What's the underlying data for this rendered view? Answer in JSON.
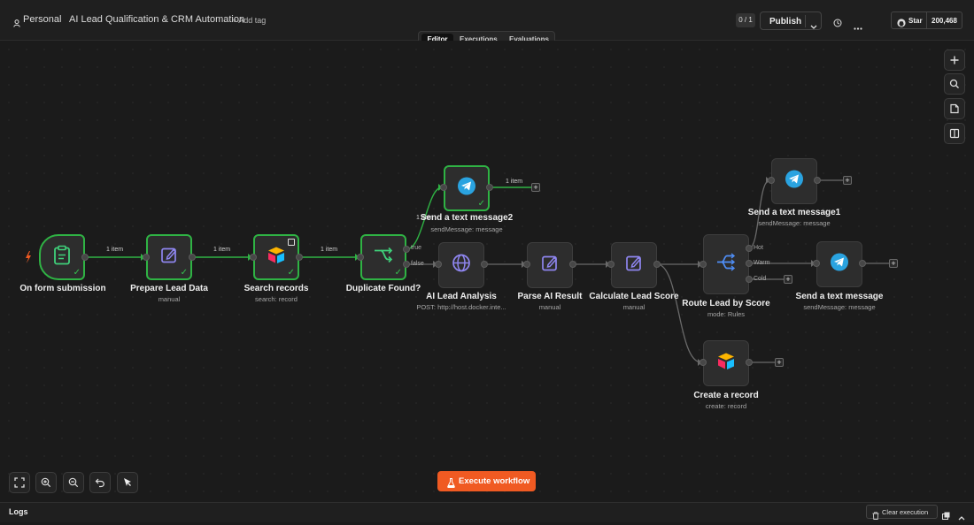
{
  "header": {
    "project": "Personal",
    "workflow_name": "AI Lead Qualification & CRM Automation",
    "add_tag": "+ Add tag",
    "tabs": [
      "Editor",
      "Executions",
      "Evaluations"
    ],
    "active_tab": "Editor",
    "version_counter": "0 / 1",
    "publish_label": "Publish",
    "github_star_label": "Star",
    "github_star_count": "200,468"
  },
  "nodes": {
    "form": {
      "label": "On form submission"
    },
    "prepare": {
      "label": "Prepare Lead Data",
      "sub": "manual"
    },
    "search": {
      "label": "Search records",
      "sub": "search: record"
    },
    "duplicate": {
      "label": "Duplicate Found?"
    },
    "send2": {
      "label": "Send a text message2",
      "sub": "sendMessage: message"
    },
    "ai": {
      "label": "AI Lead Analysis",
      "sub": "POST: http://host.docker.inte..."
    },
    "parse": {
      "label": "Parse AI Result",
      "sub": "manual"
    },
    "calc": {
      "label": "Calculate Lead Score",
      "sub": "manual"
    },
    "route": {
      "label": "Route Lead by Score",
      "sub": "mode: Rules"
    },
    "send1": {
      "label": "Send a text message1",
      "sub": "sendMessage: message"
    },
    "send": {
      "label": "Send a text message",
      "sub": "sendMessage: message"
    },
    "create": {
      "label": "Create a record",
      "sub": "create: record"
    }
  },
  "edges": {
    "item_label": "1 item",
    "true_label": "true",
    "false_label": "false",
    "hot": "Hot",
    "warm": "Warm",
    "cold": "Cold",
    "plus": "+"
  },
  "bottom": {
    "execute_label": "Execute workflow",
    "logs_label": "Logs",
    "clear_label": "Clear execution"
  },
  "colors": {
    "success": "#2fb344",
    "accent": "#f05a22",
    "telegram": "#2aa3e0",
    "node_icon": "#8f86f0"
  }
}
